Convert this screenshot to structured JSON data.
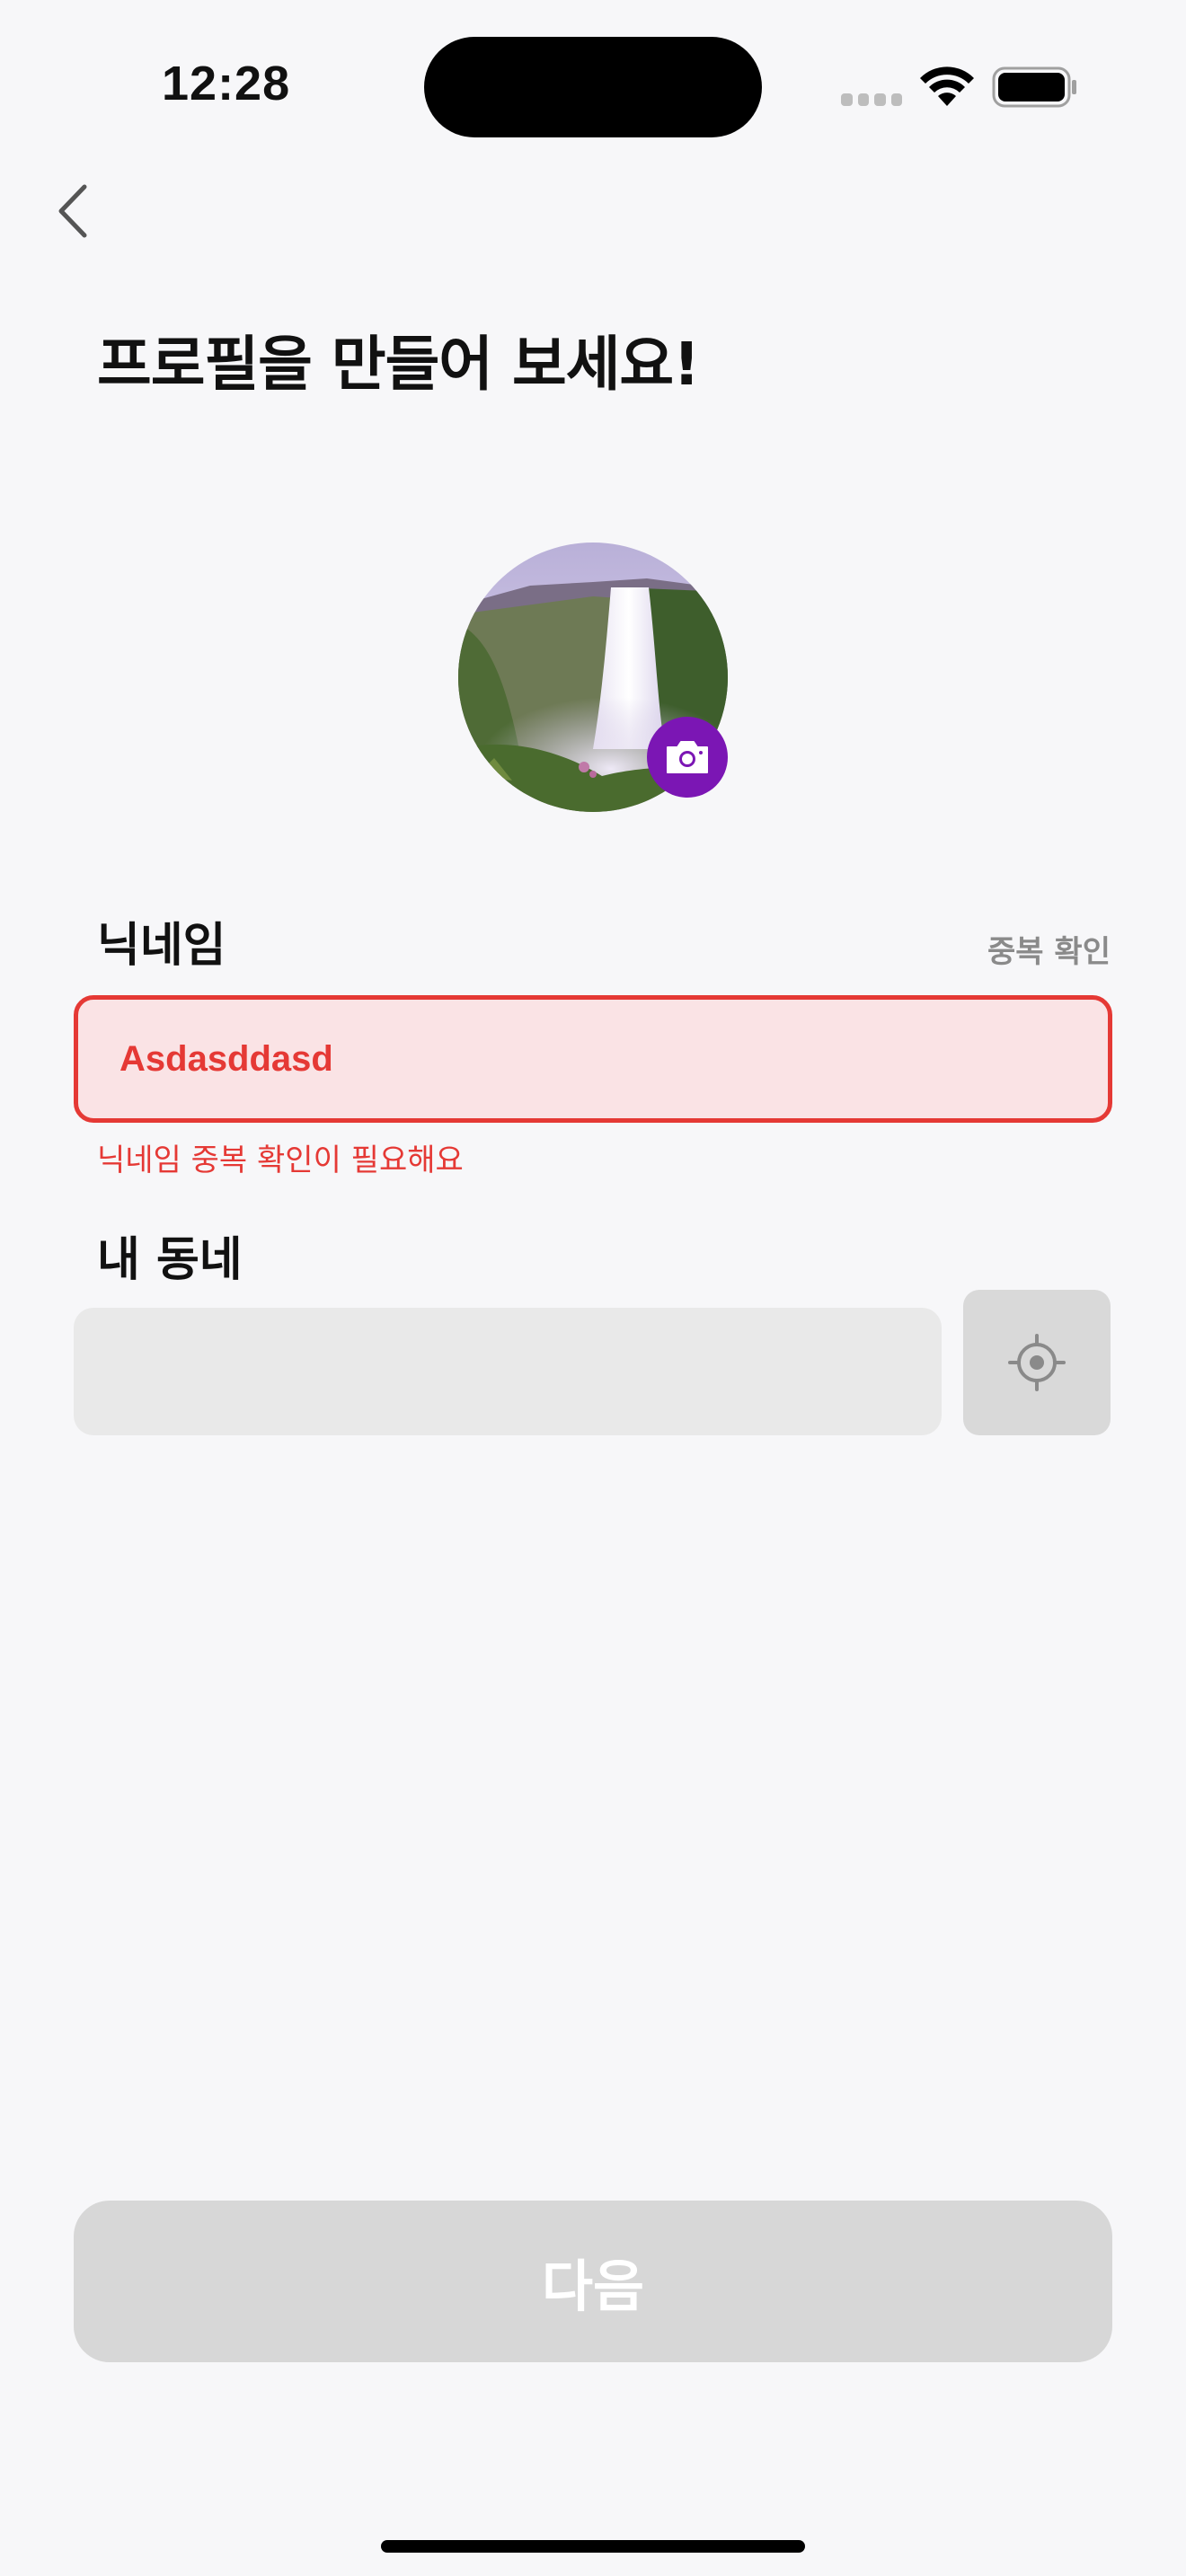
{
  "status_bar": {
    "time": "12:28"
  },
  "header": {
    "title": "프로필을 만들어 보세요!"
  },
  "profile": {
    "avatar": "waterfall-photo",
    "camera_icon": "camera-icon"
  },
  "nickname": {
    "label": "닉네임",
    "duplicate_check_label": "중복 확인",
    "value": "Asdasddasd",
    "error": "닉네임 중복 확인이 필요해요",
    "error_color": "#E53935"
  },
  "neighborhood": {
    "label": "내 동네",
    "value": "",
    "locate_icon": "location-target-icon"
  },
  "footer": {
    "next_label": "다음"
  },
  "colors": {
    "accent": "#7B16B4",
    "background": "#F7F7F9",
    "disabled": "#D7D7D7"
  }
}
